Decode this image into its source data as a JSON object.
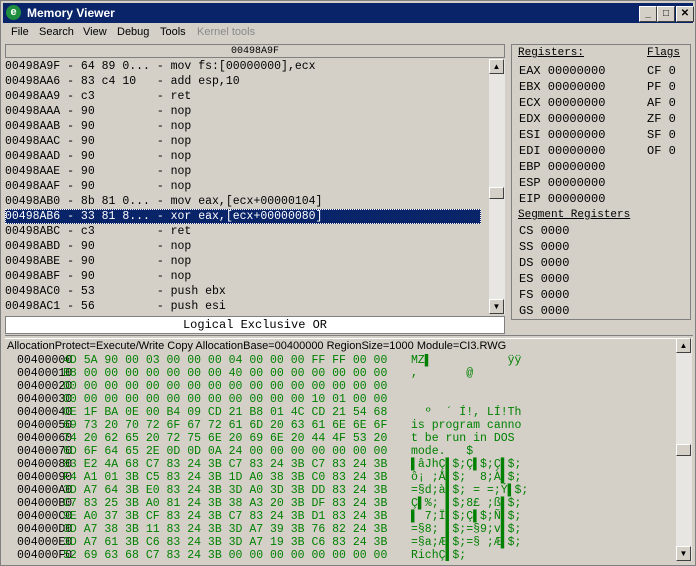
{
  "window": {
    "title": "Memory Viewer",
    "app_icon": "ce-logo-icon",
    "min_glyph": "_",
    "max_glyph": "□",
    "close_glyph": "✕"
  },
  "menu": {
    "file": "File",
    "search": "Search",
    "view": "View",
    "debug": "Debug",
    "tools": "Tools",
    "kernel_tools": "Kernel tools"
  },
  "disassembler": {
    "header_address": "00498A9F",
    "rows": [
      "00498A9F - 64 89 0... - mov fs:[00000000],ecx",
      "00498AA6 - 83 c4 10   - add esp,10",
      "00498AA9 - c3         - ret",
      "00498AAA - 90         - nop",
      "00498AAB - 90         - nop",
      "00498AAC - 90         - nop",
      "00498AAD - 90         - nop",
      "00498AAE - 90         - nop",
      "00498AAF - 90         - nop",
      "00498AB0 - 8b 81 0... - mov eax,[ecx+00000104]",
      "00498AB6 - 33 81 8... - xor eax,[ecx+00000080]",
      "00498ABC - c3         - ret",
      "00498ABD - 90         - nop",
      "00498ABE - 90         - nop",
      "00498ABF - 90         - nop",
      "00498AC0 - 53         - push ebx",
      "00498AC1 - 56         - push esi"
    ],
    "selected_index": 10,
    "description": "Logical Exclusive OR"
  },
  "registers": {
    "title": "Registers:",
    "list": [
      "EAX 00000000",
      "EBX 00000000",
      "ECX 00000000",
      "EDX 00000000",
      "ESI 00000000",
      "EDI 00000000",
      "EBP 00000000",
      "ESP 00000000",
      "EIP 00000000"
    ],
    "flags_title": "Flags",
    "flags": [
      "CF 0",
      "PF 0",
      "AF 0",
      "ZF 0",
      "SF 0",
      "OF 0"
    ],
    "segment_title": "Segment Registers",
    "segments": [
      "CS 0000",
      "SS 0000",
      "DS 0000",
      "ES 0000",
      "FS 0000",
      "GS 0000"
    ]
  },
  "hexview": {
    "info": "AllocationProtect=Execute/Write Copy  AllocationBase=00400000 RegionSize=1000 Module=CI3.RWG",
    "rows": [
      {
        "addr": "00400000",
        "bytes": "4D 5A 90 00 03 00 00 00 04 00 00 00 FF FF 00 00",
        "ascii": "MZ▌           ÿÿ"
      },
      {
        "addr": "00400010",
        "bytes": "B8 00 00 00 00 00 00 00 40 00 00 00 00 00 00 00",
        "ascii": ",       @"
      },
      {
        "addr": "00400020",
        "bytes": "00 00 00 00 00 00 00 00 00 00 00 00 00 00 00 00",
        "ascii": ""
      },
      {
        "addr": "00400030",
        "bytes": "00 00 00 00 00 00 00 00 00 00 00 00 10 01 00 00",
        "ascii": ""
      },
      {
        "addr": "00400040",
        "bytes": "0E 1F BA 0E 00 B4 09 CD 21 B8 01 4C CD 21 54 68",
        "ascii": "  º  ´ Í!, LÍ!Th"
      },
      {
        "addr": "00400050",
        "bytes": "69 73 20 70 72 6F 67 72 61 6D 20 63 61 6E 6E 6F",
        "ascii": "is program canno"
      },
      {
        "addr": "00400060",
        "bytes": "74 20 62 65 20 72 75 6E 20 69 6E 20 44 4F 53 20",
        "ascii": "t be run in DOS"
      },
      {
        "addr": "00400070",
        "bytes": "6D 6F 64 65 2E 0D 0D 0A 24 00 00 00 00 00 00 00",
        "ascii": "mode.   $"
      },
      {
        "addr": "00400080",
        "bytes": "83 E2 4A 68 C7 83 24 3B C7 83 24 3B C7 83 24 3B",
        "ascii": "▌âJhÇ▌$;Ç▌$;Ç▌$;"
      },
      {
        "addr": "00400090",
        "bytes": "F4 A1 01 3B C5 83 24 3B 1D A0 38 3B C0 83 24 3B",
        "ascii": "ô¡ ;Å▌$;  8;À▌$;"
      },
      {
        "addr": "004000A0",
        "bytes": "3D A7 64 3B E0 83 24 3B 3D A0 3D 3B DD 83 24 3B",
        "ascii": "=§d;à▌$; = =;Ý▌$;"
      },
      {
        "addr": "004000B0",
        "bytes": "C7 83 25 3B A0 81 24 3B 38 A3 20 3B DF 83 24 3B",
        "ascii": "Ç▌%; ▌$;8£ ;ß▌$;"
      },
      {
        "addr": "004000C0",
        "bytes": "9E A0 37 3B CF 83 24 3B C7 83 24 3B D1 83 24 3B",
        "ascii": "▌ 7;Ï▌$;Ç▌$;Ñ▌$;"
      },
      {
        "addr": "004000D0",
        "bytes": "3D A7 38 3B 11 83 24 3B 3D A7 39 3B 76 82 24 3B",
        "ascii": "=§8; ▌$;=§9;v▌$;"
      },
      {
        "addr": "004000E0",
        "bytes": "3D A7 61 3B C6 83 24 3B 3D A7 19 3B C6 83 24 3B",
        "ascii": "=§a;Æ▌$;=§ ;Æ▌$;"
      },
      {
        "addr": "004000F0",
        "bytes": "52 69 63 68 C7 83 24 3B 00 00 00 00 00 00 00 00",
        "ascii": "RichÇ▌$;"
      }
    ]
  }
}
